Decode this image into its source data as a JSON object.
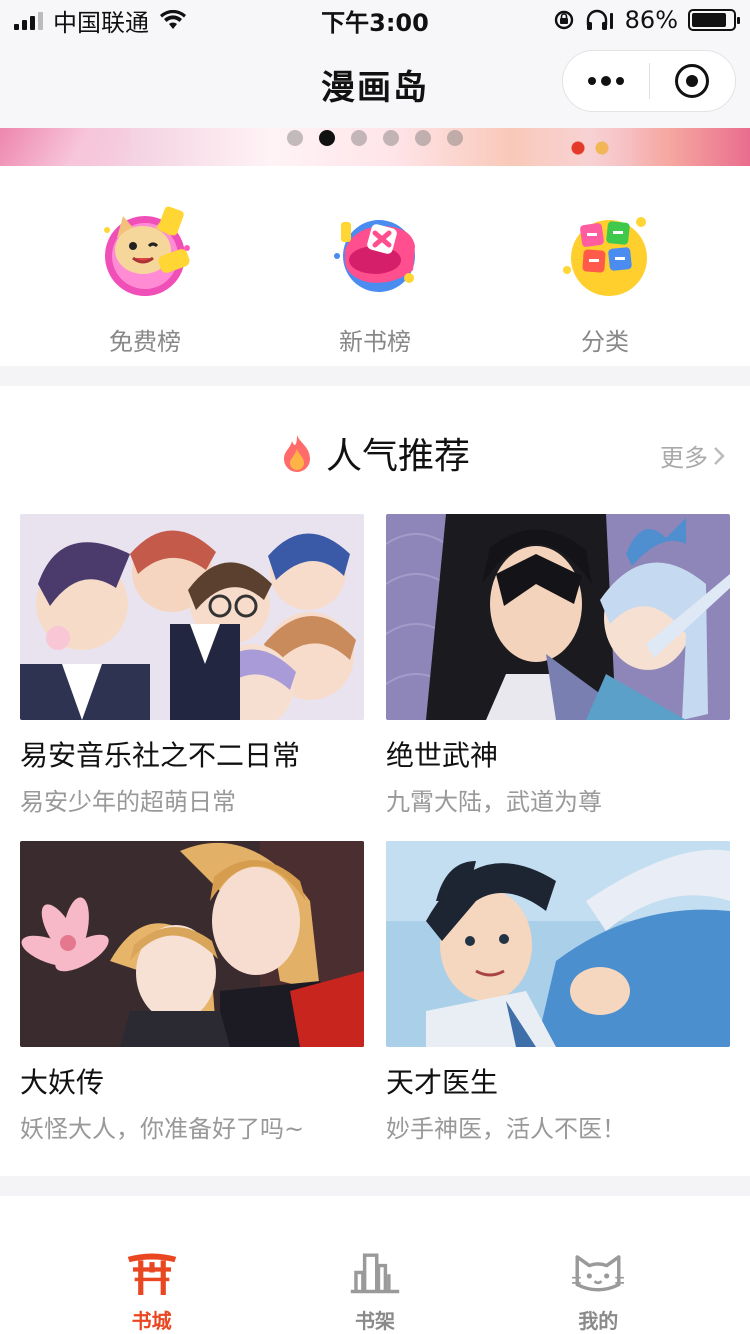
{
  "status_bar": {
    "carrier": "中国联通",
    "time": "下午3:00",
    "battery": "86%",
    "battery_level": 0.86
  },
  "nav": {
    "title": "漫画岛"
  },
  "banner": {
    "page_count": 6,
    "active_index": 1
  },
  "entries": [
    {
      "label": "免费榜",
      "icon": "cat-badge-icon"
    },
    {
      "label": "新书榜",
      "icon": "new-book-badge-icon"
    },
    {
      "label": "分类",
      "icon": "category-blocks-icon"
    }
  ],
  "section": {
    "title": "人气推荐",
    "more_label": "更多",
    "icon": "fire-icon"
  },
  "books": [
    {
      "title": "易安音乐社之不二日常",
      "subtitle": "易安少年的超萌日常"
    },
    {
      "title": "绝世武神",
      "subtitle": "九霄大陆，武道为尊"
    },
    {
      "title": "大妖传",
      "subtitle": "妖怪大人，你准备好了吗~"
    },
    {
      "title": "天才医生",
      "subtitle": "妙手神医，活人不医！"
    }
  ],
  "tabs": [
    {
      "label": "书城",
      "icon": "torii-gate-icon",
      "active": true
    },
    {
      "label": "书架",
      "icon": "bookshelf-icon",
      "active": false
    },
    {
      "label": "我的",
      "icon": "cat-face-icon",
      "active": false
    }
  ],
  "colors": {
    "accent": "#e94721",
    "muted_text": "#999999",
    "background": "#f4f4f6"
  }
}
